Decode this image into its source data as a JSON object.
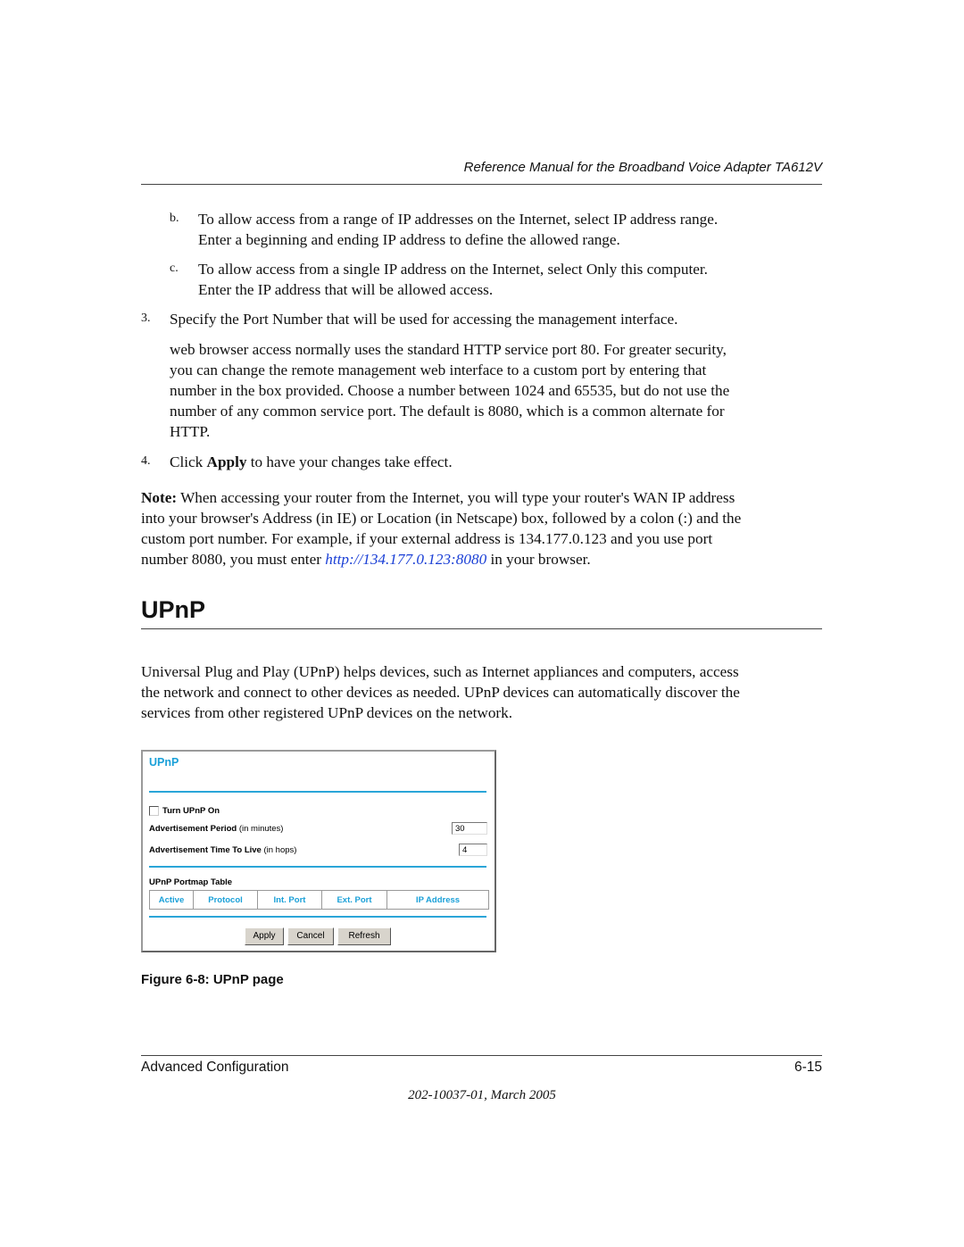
{
  "header": {
    "title": "Reference Manual for the Broadband Voice Adapter TA612V"
  },
  "steps": {
    "b": {
      "marker": "b.",
      "line1": "To allow access from a range of IP addresses on the Internet, select IP address range.",
      "line2": "Enter a beginning and ending IP address to define the allowed range."
    },
    "c": {
      "marker": "c.",
      "line1": "To allow access from a single IP address on the Internet, select Only this computer.",
      "line2": "Enter the IP address that will be allowed access."
    },
    "s3": {
      "marker": "3.",
      "text": "Specify the Port Number that will be used for accessing the management interface.",
      "detail": [
        "web browser access normally uses the standard HTTP service port 80. For greater security,",
        "you can change the remote management web interface to a custom port by entering that",
        "number in the box provided. Choose a number between 1024 and 65535, but do not use the",
        "number of any common service port. The default is 8080, which is a common alternate for",
        "HTTP."
      ]
    },
    "s4": {
      "marker": "4.",
      "pre": "Click ",
      "bold": "Apply",
      "post": " to have your changes take effect."
    }
  },
  "note": {
    "label": "Note:",
    "line1": " When accessing your router from the Internet, you will type your router's WAN IP address",
    "line2": "into your browser's Address (in IE) or Location (in Netscape) box, followed by a colon (:) and the",
    "line3": "custom port number. For example, if your external address is 134.177.0.123 and you use port",
    "line4_pre": "number 8080, you must enter ",
    "link": "http://134.177.0.123:8080",
    "line4_post": " in your browser."
  },
  "section": {
    "heading": "UPnP",
    "intro": [
      "Universal Plug and Play (UPnP) helps devices, such as Internet appliances and computers, access",
      "the network and connect to other devices as needed. UPnP devices can automatically discover the",
      "services from other registered UPnP devices on the network."
    ]
  },
  "figure": {
    "title": "UPnP",
    "turn_on_label": "Turn UPnP On",
    "turn_on_checked": false,
    "adv_period_label": "Advertisement Period",
    "adv_period_unit": " (in minutes)",
    "adv_period_value": "30",
    "adv_ttl_label": "Advertisement Time To Live",
    "adv_ttl_unit": " (in hops)",
    "adv_ttl_value": "4",
    "table_title": "UPnP Portmap Table",
    "columns": [
      "Active",
      "Protocol",
      "Int. Port",
      "Ext. Port",
      "IP Address"
    ],
    "buttons": {
      "apply": "Apply",
      "cancel": "Cancel",
      "refresh": "Refresh"
    },
    "accent_color": "#1aa0d8"
  },
  "caption": "Figure 6-8:  UPnP page",
  "footer": {
    "left": "Advanced Configuration",
    "right": "6-15",
    "center": "202-10037-01, March 2005"
  }
}
